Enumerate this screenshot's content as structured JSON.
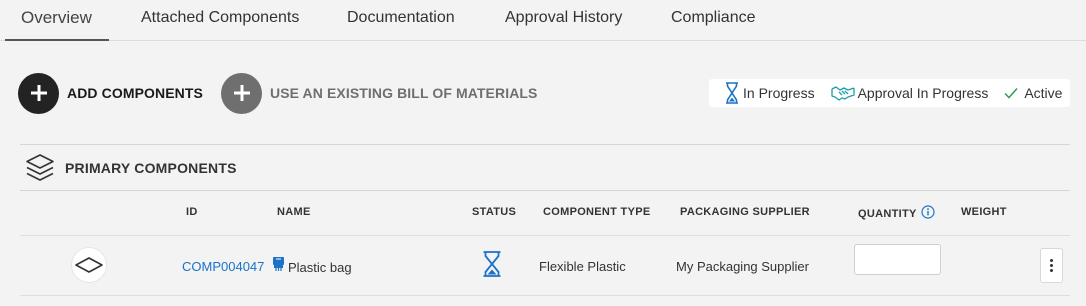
{
  "tabs": [
    {
      "label": "Overview",
      "active": true
    },
    {
      "label": "Attached Components"
    },
    {
      "label": "Documentation"
    },
    {
      "label": "Approval History"
    },
    {
      "label": "Compliance"
    }
  ],
  "actions": {
    "add_components": {
      "label": "ADD COMPONENTS",
      "icon": "plus-icon"
    },
    "use_existing_bom": {
      "label": "USE AN EXISTING BILL OF MATERIALS",
      "icon": "plus-icon"
    }
  },
  "legend": [
    {
      "label": "In Progress",
      "icon": "hourglass-icon",
      "color": "#1a73c8"
    },
    {
      "label": "Approval In Progress",
      "icon": "handshake-icon",
      "color": "#1a9fa8"
    },
    {
      "label": "Active",
      "icon": "checkmark-icon",
      "color": "#2e9e4f"
    }
  ],
  "panel": {
    "title": "PRIMARY COMPONENTS",
    "icon": "layers-icon"
  },
  "table": {
    "headers": {
      "id": "ID",
      "name": "NAME",
      "status": "STATUS",
      "component_type": "COMPONENT TYPE",
      "packaging_supplier": "PACKAGING SUPPLIER",
      "quantity": "QUANTITY",
      "weight": "WEIGHT"
    },
    "rows": [
      {
        "thumbnail_icon": "flexible-plastic-icon",
        "id": "COMP004047",
        "name_icon": "bag-icon",
        "name": "Plastic bag",
        "status_icon": "hourglass-icon",
        "component_type": "Flexible Plastic",
        "packaging_supplier": "My Packaging Supplier",
        "quantity": "",
        "weight": ""
      }
    ]
  },
  "colors": {
    "link": "#1a73c8",
    "in_progress": "#1a73c8",
    "approval": "#1a9fa8",
    "active": "#2e9e4f",
    "dark_button": "#232323",
    "grey_button": "#6f6f6f"
  }
}
